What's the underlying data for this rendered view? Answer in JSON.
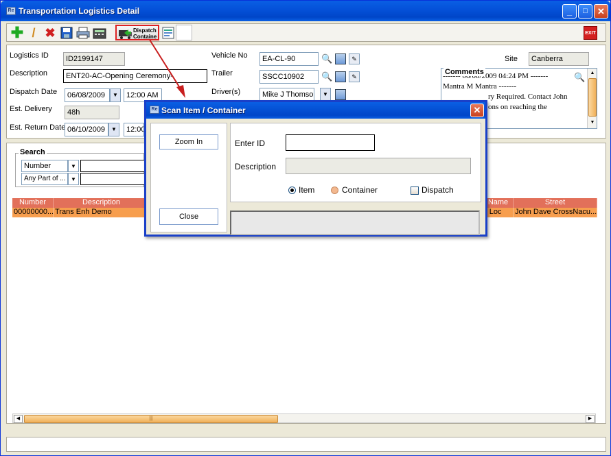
{
  "window": {
    "title": "Transportation Logistics Detail",
    "app_icon": "Re",
    "controls": [
      "_",
      "□",
      "✕"
    ]
  },
  "toolbar": {
    "dispatch_label_1": "Dispatch",
    "dispatch_label_2": "Containe",
    "exit_label": "EXIT"
  },
  "header": {
    "logistics_id_label": "Logistics ID",
    "logistics_id": "ID2199147",
    "description_label": "Description",
    "description": "ENT20-AC-Opening Ceremony-",
    "dispatch_date_label": "Dispatch Date",
    "dispatch_date": "06/08/2009",
    "dispatch_time": "12:00 AM",
    "est_delivery_label": "Est. Delivery",
    "est_delivery": "48h",
    "est_return_label": "Est. Return Date",
    "est_return_date": "06/10/2009",
    "est_return_time": "12:00",
    "vehicle_label": "Vehicle No",
    "vehicle": "EA-CL-90",
    "trailer_label": "Trailer",
    "trailer": "SSCC10902",
    "drivers_label": "Driver(s)",
    "drivers": "Mike J Thomson",
    "site_label": "Site",
    "site": "Canberra",
    "comments_label": "Comments",
    "comments_lines": [
      "------- 06/08/2009 04:24 PM -------",
      "Mantra M Mantra -------",
      "ry Required. Contact John",
      "ons on reaching the"
    ]
  },
  "grid": {
    "search_legend": "Search",
    "search_field": "Number",
    "search_mode": "Any Part of ...",
    "columns": [
      "Number",
      "Description",
      "Name",
      "Street"
    ],
    "row": {
      "number": "00000000...",
      "description": "Trans Enh Demo",
      "name": "r Loc",
      "street": "John  Dave CrossNacu..."
    },
    "scroll_grip": "|||"
  },
  "dialog": {
    "title": "Scan Item / Container",
    "zoom_in": "Zoom In",
    "close": "Close",
    "enter_id_label": "Enter ID",
    "enter_id_value": "",
    "description_label": "Description",
    "description_value": "",
    "radio_item": "Item",
    "radio_container": "Container",
    "check_dispatch": "Dispatch",
    "selected": "Item"
  },
  "colors": {
    "titlebar": "#0450d8",
    "grid_header": "#e2705a",
    "selected_row": "#f79e4e",
    "callout_arrow": "#c81e1e"
  }
}
